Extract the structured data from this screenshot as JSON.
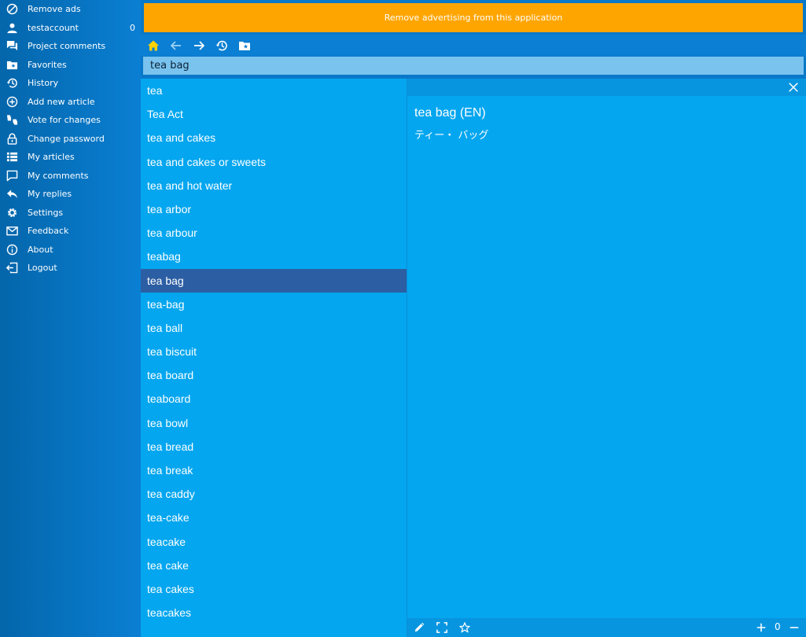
{
  "colors": {
    "ad_banner": "#ffa500",
    "selected_row": "#2c5ea3",
    "list_bg": "#04a6ef",
    "home_icon": "#ffd200"
  },
  "sidebar": {
    "items": [
      {
        "label": "Remove ads",
        "icon": "no-ads-icon"
      },
      {
        "label": "testaccount",
        "icon": "user-icon",
        "count": "0"
      },
      {
        "label": "Project comments",
        "icon": "comments-icon"
      },
      {
        "label": "Favorites",
        "icon": "favorites-folder-icon"
      },
      {
        "label": "History",
        "icon": "history-icon"
      },
      {
        "label": "Add new article",
        "icon": "add-circle-icon"
      },
      {
        "label": "Vote for changes",
        "icon": "vote-icon"
      },
      {
        "label": "Change password",
        "icon": "lock-icon"
      },
      {
        "label": "My articles",
        "icon": "list-icon"
      },
      {
        "label": "My comments",
        "icon": "comment-icon"
      },
      {
        "label": "My replies",
        "icon": "reply-icon"
      },
      {
        "label": "Settings",
        "icon": "gear-icon"
      },
      {
        "label": "Feedback",
        "icon": "mail-icon"
      },
      {
        "label": "About",
        "icon": "info-icon"
      },
      {
        "label": "Logout",
        "icon": "logout-icon"
      }
    ]
  },
  "ad_banner": {
    "text": "Remove advertising from this application"
  },
  "toolbar": {
    "buttons": [
      "home-icon",
      "back-arrow-icon",
      "forward-arrow-icon",
      "history-icon",
      "favorites-folder-icon"
    ]
  },
  "search": {
    "value": "tea bag"
  },
  "word_list": {
    "selected_index": 8,
    "items": [
      "tea",
      "Tea Act",
      "tea and cakes",
      "tea and cakes or sweets",
      "tea and hot water",
      "tea arbor",
      "tea arbour",
      "teabag",
      "tea bag",
      "tea-bag",
      "tea ball",
      "tea biscuit",
      "tea board",
      "teaboard",
      "tea bowl",
      "tea bread",
      "tea break",
      "tea caddy",
      "tea-cake",
      "teacake",
      "tea cake",
      "tea cakes",
      "teacakes"
    ]
  },
  "entry": {
    "title": "tea bag (EN)",
    "translation": "ティー・ バッグ"
  },
  "footer": {
    "buttons": [
      "edit-pencil-icon",
      "fullscreen-icon",
      "star-icon"
    ],
    "zoom_value": "0"
  }
}
